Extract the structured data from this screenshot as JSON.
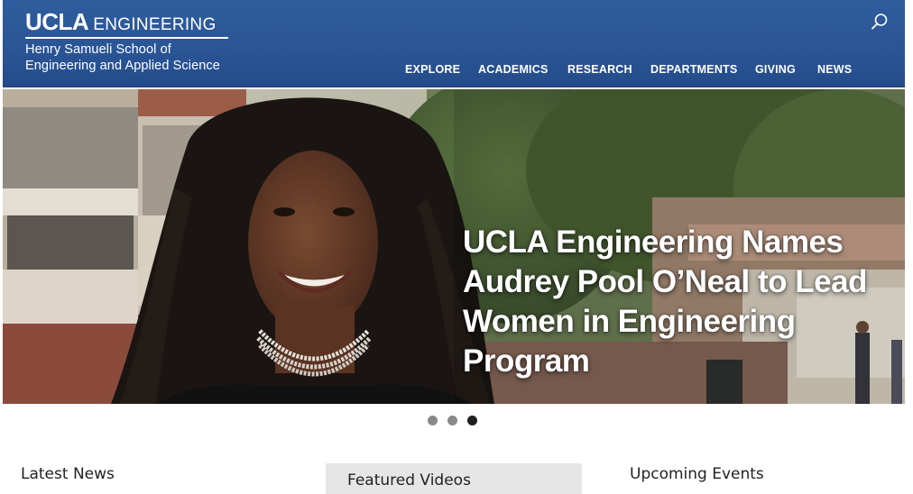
{
  "header": {
    "logo": {
      "ucla": "UCLA",
      "engineering": "ENGINEERING",
      "school_line1": "Henry Samueli School of",
      "school_line2": "Engineering and Applied Science"
    },
    "search_icon": "search-icon",
    "nav": [
      {
        "label": "EXPLORE"
      },
      {
        "label": "ACADEMICS"
      },
      {
        "label": "RESEARCH"
      },
      {
        "label": "DEPARTMENTS"
      },
      {
        "label": "GIVING"
      },
      {
        "label": "NEWS"
      }
    ]
  },
  "hero": {
    "headline": "UCLA Engineering Names Audrey Pool O’Neal to Lead Women in Engineering Program",
    "slides": 3,
    "active_slide": 3
  },
  "sections": {
    "latest_news": "Latest News",
    "featured_videos": "Featured Videos",
    "upcoming_events": "Upcoming Events"
  },
  "colors": {
    "header_blue": "#2a5596",
    "text_white": "#ffffff",
    "dot_inactive": "#8a8a8a",
    "dot_active": "#1f1f1f"
  }
}
